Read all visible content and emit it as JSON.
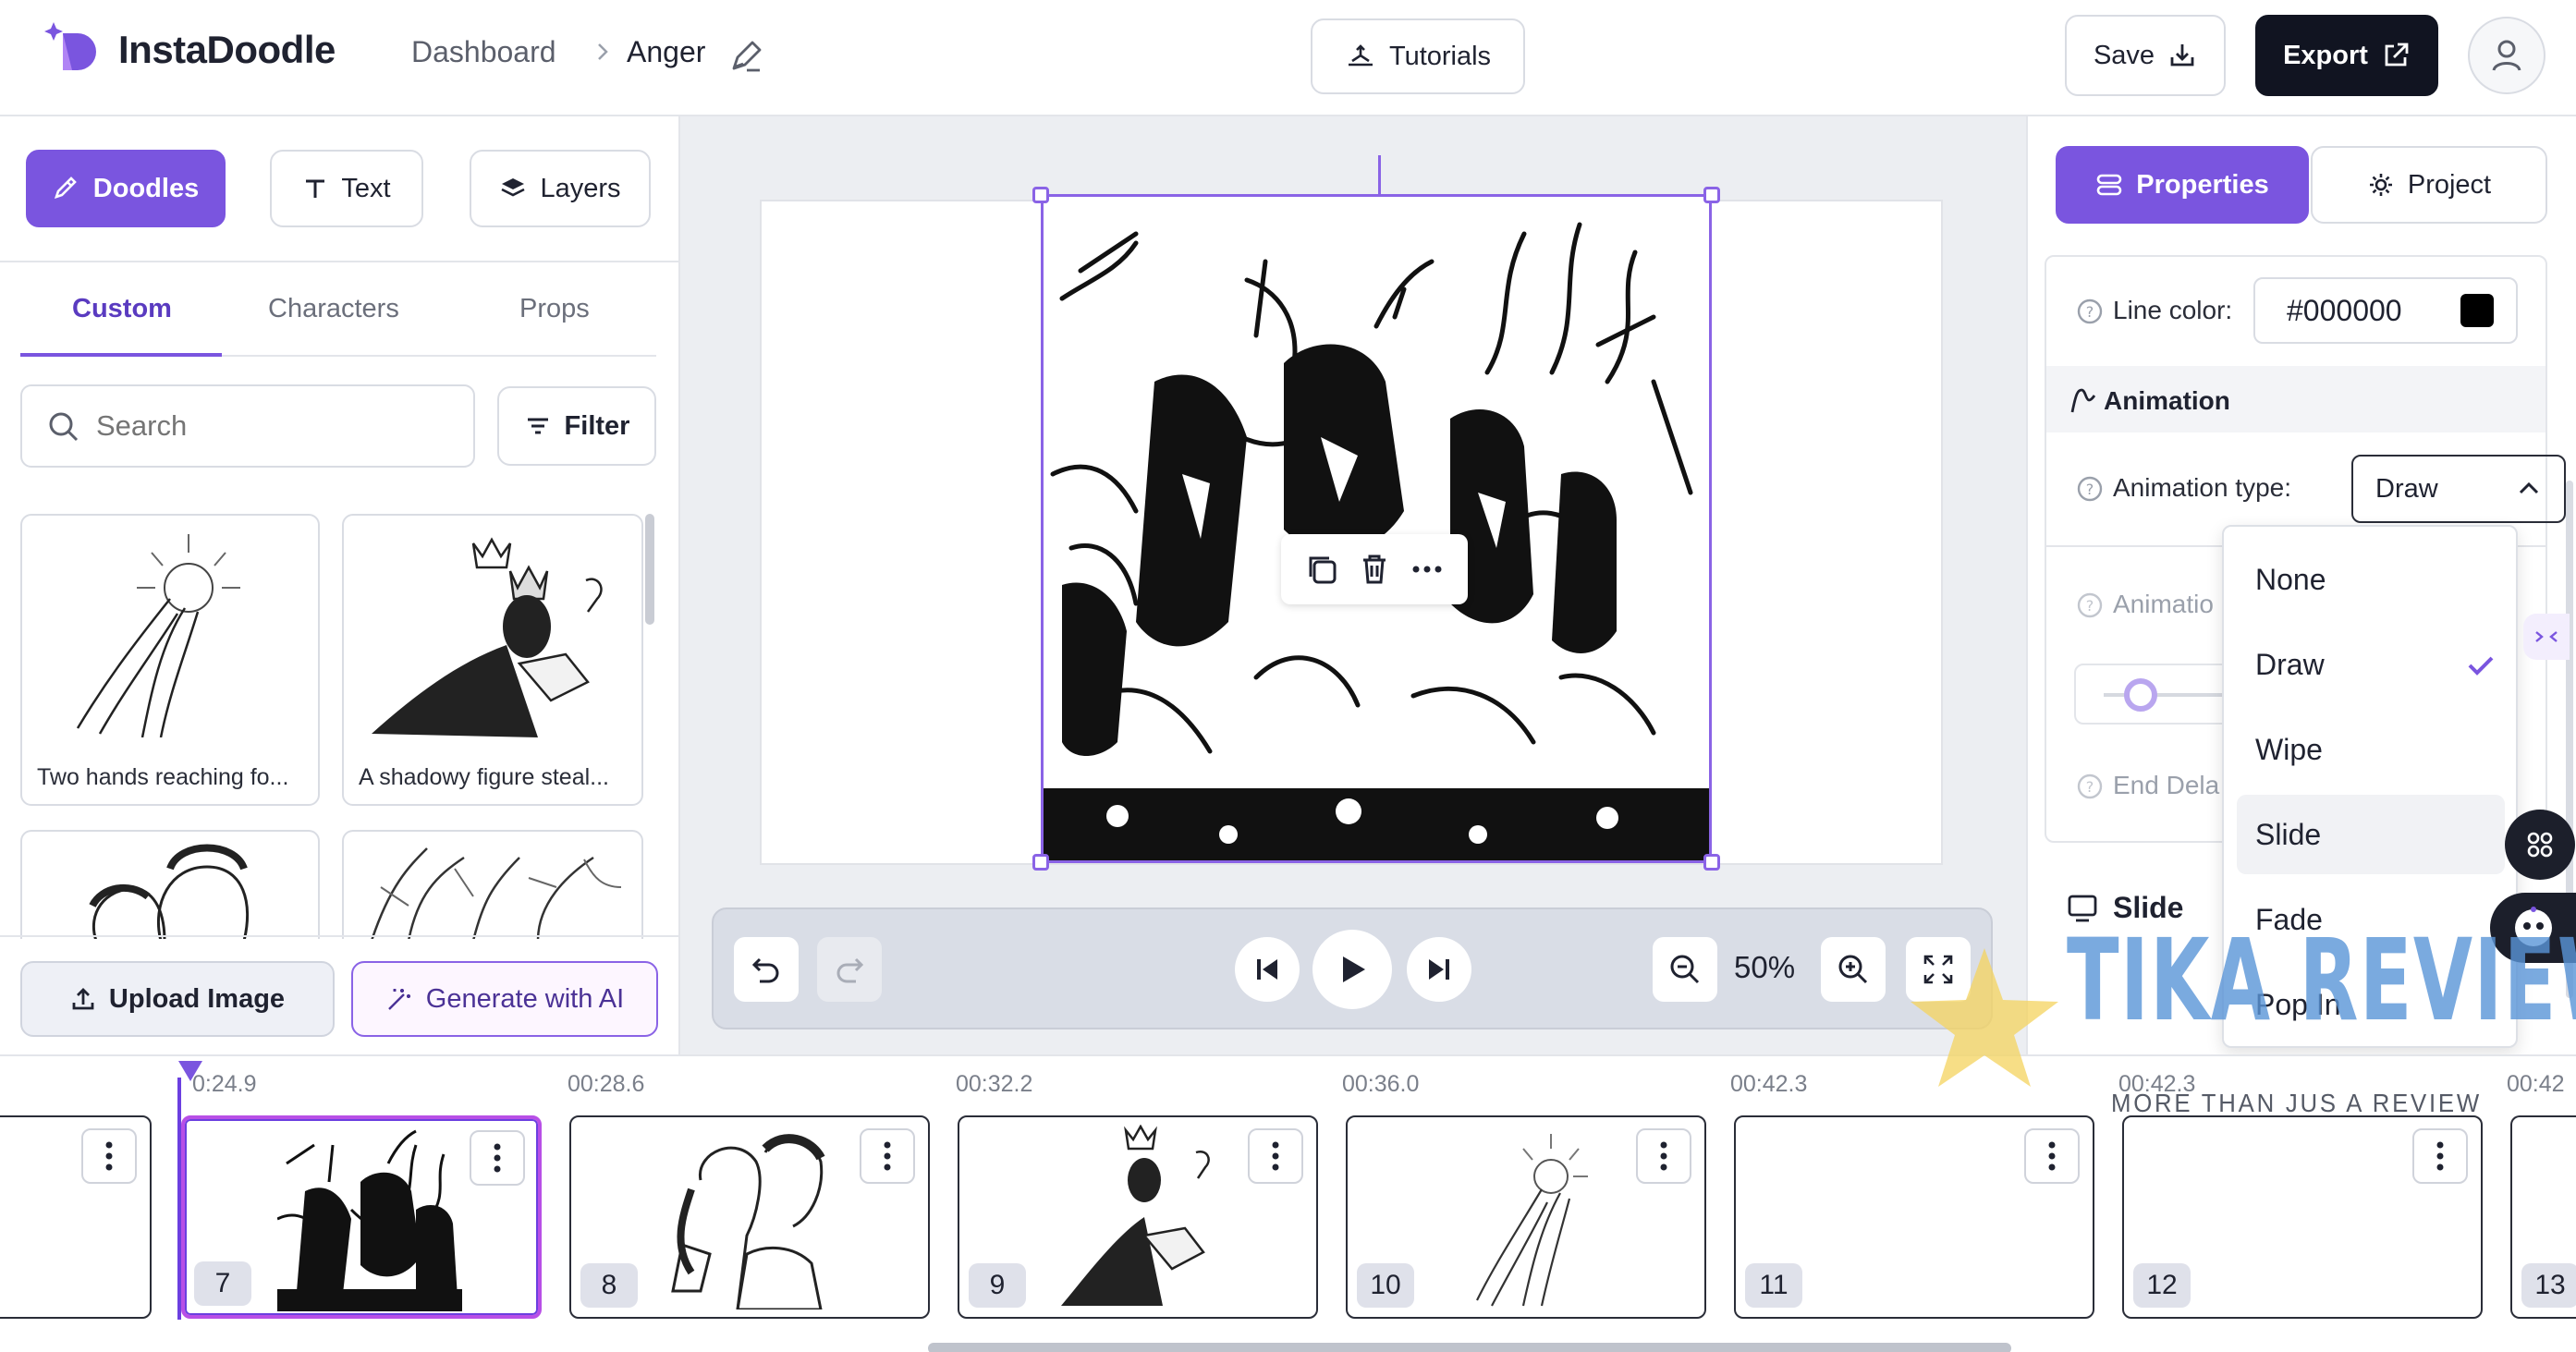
{
  "header": {
    "app_name": "InstaDoodle",
    "breadcrumb_root": "Dashboard",
    "breadcrumb_current": "Anger",
    "tutorials_label": "Tutorials",
    "save_label": "Save",
    "export_label": "Export"
  },
  "left_panel": {
    "tabs": [
      {
        "label": "Doodles",
        "active": true
      },
      {
        "label": "Text",
        "active": false
      },
      {
        "label": "Layers",
        "active": false
      }
    ],
    "subtabs": [
      {
        "label": "Custom",
        "active": true
      },
      {
        "label": "Characters",
        "active": false
      },
      {
        "label": "Props",
        "active": false
      }
    ],
    "search_placeholder": "Search",
    "filter_label": "Filter",
    "thumbnails": [
      {
        "caption": "Two hands reaching fo..."
      },
      {
        "caption": "A shadowy figure steal..."
      }
    ],
    "upload_label": "Upload Image",
    "generate_label": "Generate with AI"
  },
  "canvas": {
    "zoom": "50%"
  },
  "right_panel": {
    "tabs": [
      {
        "label": "Properties",
        "active": true
      },
      {
        "label": "Project",
        "active": false
      }
    ],
    "line_color_label": "Line color:",
    "line_color_value": "#000000",
    "animation_section": "Animation",
    "animation_type_label": "Animation type:",
    "animation_type_value": "Draw",
    "animation_partial_label": "Animatio",
    "end_delay_partial_label": "End Dela",
    "slide_section": "Slide",
    "animation_options": [
      {
        "label": "None",
        "selected": false,
        "hovered": false
      },
      {
        "label": "Draw",
        "selected": true,
        "hovered": false
      },
      {
        "label": "Wipe",
        "selected": false,
        "hovered": false
      },
      {
        "label": "Slide",
        "selected": false,
        "hovered": true
      },
      {
        "label": "Fade",
        "selected": false,
        "hovered": false
      },
      {
        "label": "Pop In",
        "selected": false,
        "hovered": false
      }
    ]
  },
  "timeline": {
    "time_labels": [
      "0:24.9",
      "00:28.6",
      "00:32.2",
      "00:36.0",
      "00:42.3",
      "00:42.3",
      "00:42"
    ],
    "frames": [
      {
        "number": "",
        "selected": false
      },
      {
        "number": "7",
        "selected": true
      },
      {
        "number": "8",
        "selected": false
      },
      {
        "number": "9",
        "selected": false
      },
      {
        "number": "10",
        "selected": false
      },
      {
        "number": "11",
        "selected": false
      },
      {
        "number": "12",
        "selected": false
      },
      {
        "number": "13",
        "selected": false
      }
    ]
  },
  "watermark": {
    "title": "TIKA REVIEW",
    "tagline": "MORE THAN JUS A REVIEW"
  },
  "colors": {
    "accent": "#7a55df",
    "dark": "#111421",
    "selection": "#8a63e6"
  }
}
